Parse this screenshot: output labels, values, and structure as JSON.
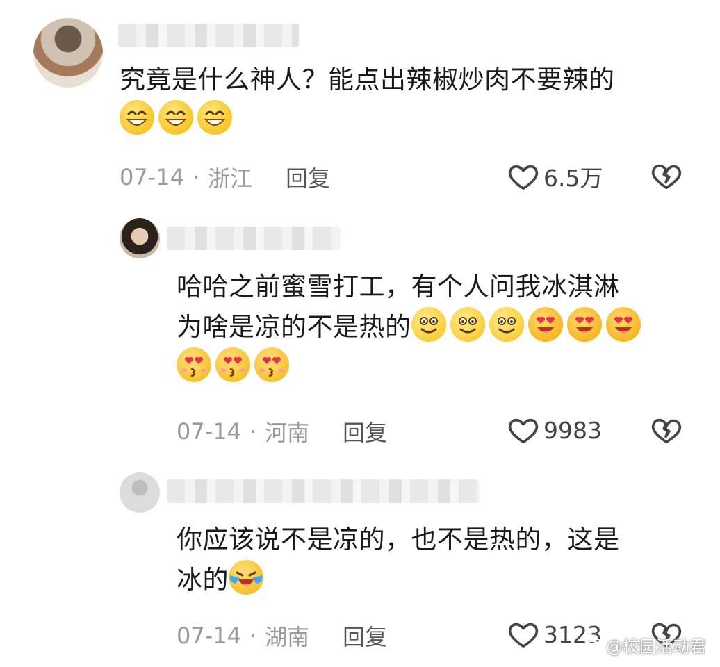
{
  "comments": [
    {
      "text_line1": "究竟是什么神人？能点出辣椒炒肉不要辣的",
      "date": "07-14",
      "separator": "·",
      "location": "浙江",
      "reply_label": "回复",
      "likes": "6.5万"
    },
    {
      "text_line1": "哈哈之前蜜雪打工，有个人问我冰淇淋",
      "text_line2": "为啥是凉的不是热的",
      "date": "07-14",
      "separator": "·",
      "location": "河南",
      "reply_label": "回复",
      "likes": "9983"
    },
    {
      "text_line1": "你应该说不是凉的，也不是热的，这是",
      "text_line2": "冰的",
      "date": "07-14",
      "separator": "·",
      "location": "湖南",
      "reply_label": "回复",
      "likes": "3123"
    }
  ],
  "watermark": {
    "handle": "@校园活动君"
  },
  "colors": {
    "meta_gray": "#9a9a9a",
    "text": "#1a1a1a",
    "emoji_yellow": "#f5b800",
    "heart_red": "#e8344a"
  }
}
